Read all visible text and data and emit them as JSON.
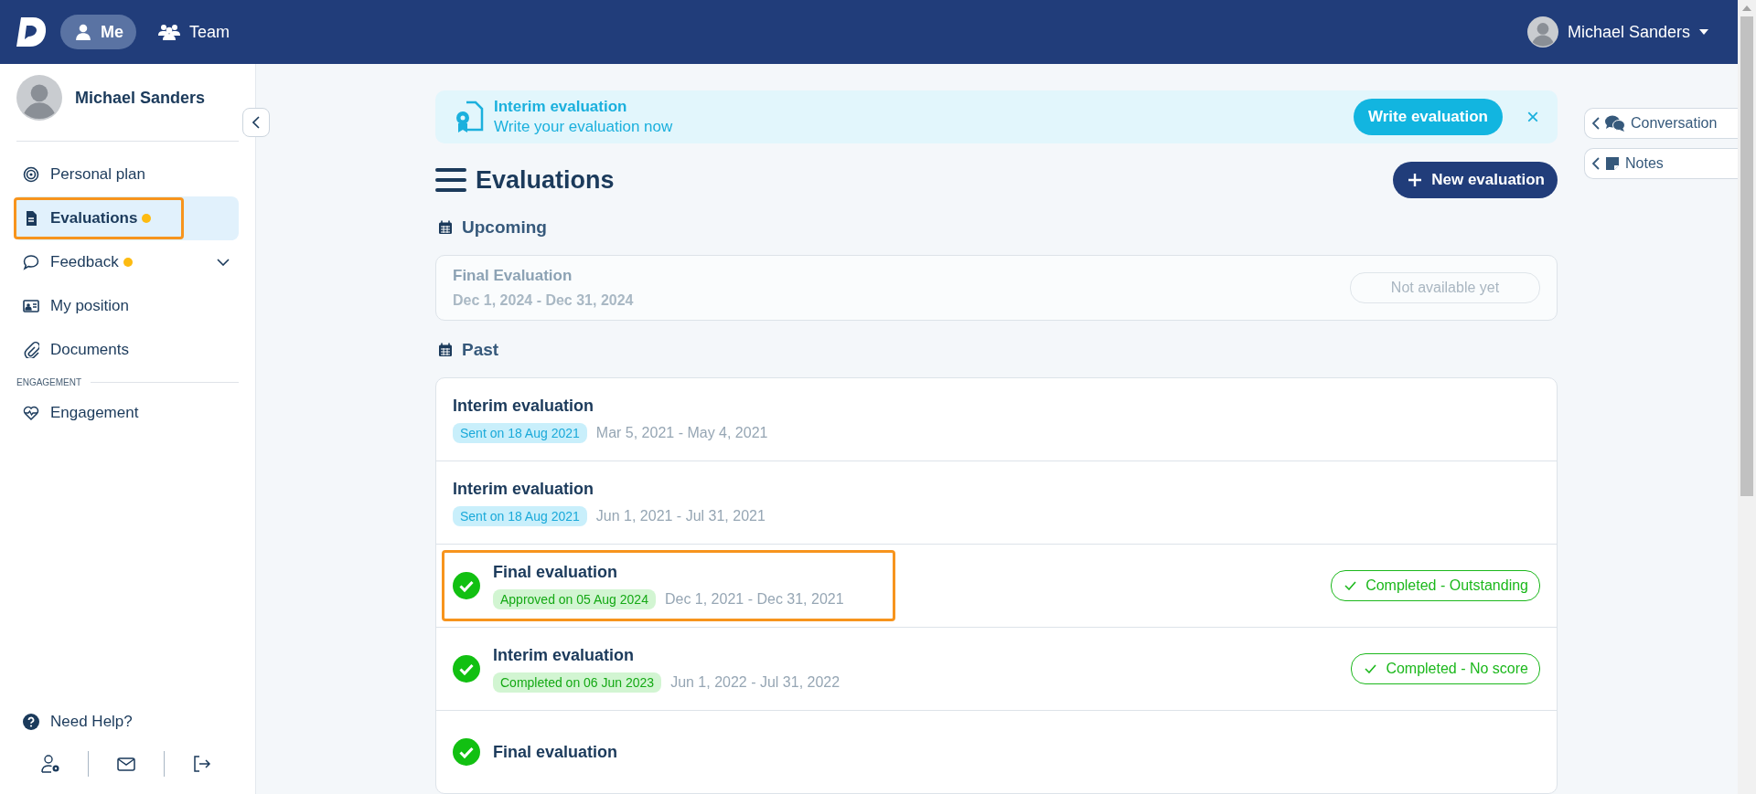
{
  "top_bar": {
    "tabs": [
      {
        "label": "Me",
        "selected": true
      },
      {
        "label": "Team",
        "selected": false
      }
    ],
    "user_name": "Michael Sanders"
  },
  "sidebar": {
    "user_name": "Michael Sanders",
    "items": [
      {
        "label": "Personal plan",
        "selected": false,
        "notification_dot": false,
        "expandable": false,
        "highlighted": false
      },
      {
        "label": "Evaluations",
        "selected": true,
        "notification_dot": true,
        "expandable": false,
        "highlighted": true
      },
      {
        "label": "Feedback",
        "selected": false,
        "notification_dot": true,
        "expandable": true,
        "highlighted": false
      },
      {
        "label": "My position",
        "selected": false,
        "notification_dot": false,
        "expandable": false,
        "highlighted": false
      },
      {
        "label": "Documents",
        "selected": false,
        "notification_dot": false,
        "expandable": false,
        "highlighted": false
      }
    ],
    "section_label": "ENGAGEMENT",
    "section_items": [
      {
        "label": "Engagement",
        "selected": false,
        "notification_dot": false,
        "expandable": false,
        "highlighted": false
      }
    ],
    "help": "Need Help?"
  },
  "banner": {
    "title": "Interim evaluation",
    "subtitle": "Write your evaluation now",
    "button": "Write evaluation",
    "close": "×"
  },
  "page_title": "Evaluations",
  "new_button": "New evaluation",
  "upcoming": {
    "heading": "Upcoming",
    "items": [
      {
        "title": "Final Evaluation",
        "dates": "Dec 1, 2024 - Dec 31, 2024",
        "action": "Not available yet",
        "disabled": true
      }
    ]
  },
  "past": {
    "heading": "Past",
    "rows": [
      {
        "kind": "sent",
        "title": "Interim evaluation",
        "badge": "Sent on 18 Aug 2021",
        "dates": "Mar 5, 2021 - May 4, 2021",
        "highlighted": false
      },
      {
        "kind": "sent",
        "title": "Interim evaluation",
        "badge": "Sent on 18 Aug 2021",
        "dates": "Jun 1, 2021 - Jul 31, 2021",
        "highlighted": false
      },
      {
        "kind": "completed",
        "title": "Final evaluation",
        "badge": "Approved on 05 Aug 2024",
        "dates": "Dec 1, 2021 - Dec 31, 2021",
        "status": "Completed - Outstanding",
        "highlighted": true
      },
      {
        "kind": "completed",
        "title": "Interim evaluation",
        "badge": "Completed on 06 Jun 2023",
        "dates": "Jun 1, 2022 - Jul 31, 2022",
        "status": "Completed - No score",
        "highlighted": false
      },
      {
        "kind": "completed",
        "title": "Final evaluation",
        "highlighted": false
      }
    ]
  },
  "side_tabs": [
    {
      "label": "Conversation"
    },
    {
      "label": "Notes"
    }
  ]
}
